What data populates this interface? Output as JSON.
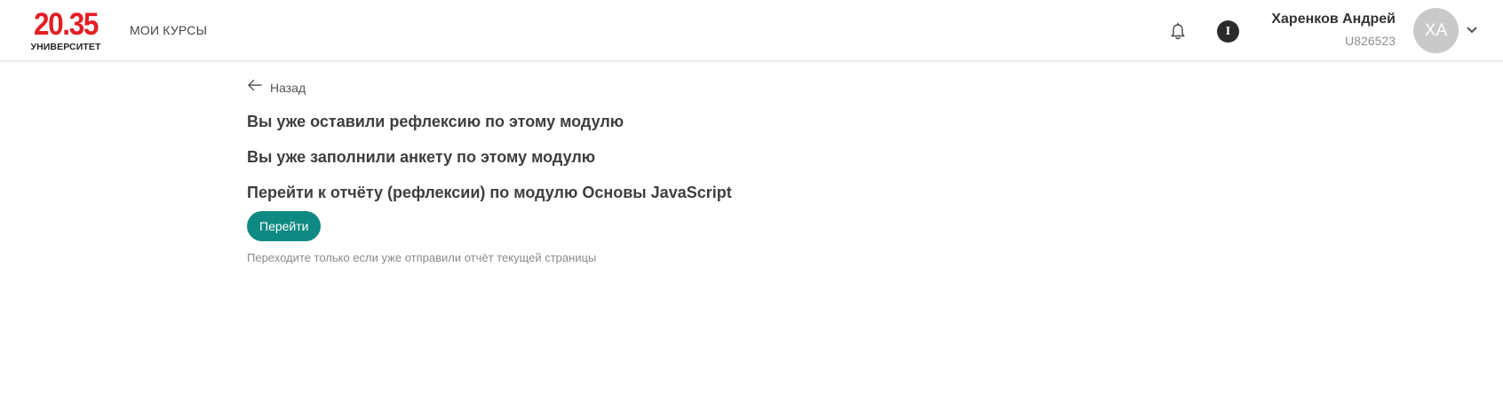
{
  "header": {
    "logo": {
      "number": "20.35",
      "subtitle": "УНИВЕРСИТЕТ"
    },
    "nav": {
      "my_courses": "МОИ КУРСЫ"
    },
    "bell_icon": "bell-icon",
    "info_badge": "I",
    "user": {
      "name": "Харенков Андрей",
      "id": "U826523",
      "initials": "ХА"
    },
    "menu_icon": "chevron-down-icon"
  },
  "main": {
    "back_label": "Назад",
    "messages": [
      "Вы уже оставили рефлексию по этому модулю",
      "Вы уже заполнили анкету по этому модулю",
      "Перейти к отчёту (рефлексии) по модулю Основы JavaScript"
    ],
    "go_button_label": "Перейти",
    "hint": "Переходите только если уже отправили отчёт текущей страницы"
  },
  "colors": {
    "brand_red": "#e31e24",
    "button_teal": "#0f8a82",
    "avatar_gray": "#c9c9c9"
  }
}
